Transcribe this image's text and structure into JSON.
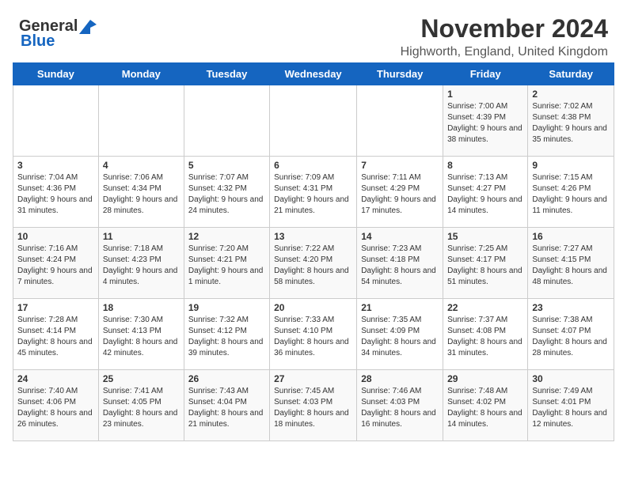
{
  "header": {
    "logo_general": "General",
    "logo_blue": "Blue",
    "month_title": "November 2024",
    "location": "Highworth, England, United Kingdom"
  },
  "days_of_week": [
    "Sunday",
    "Monday",
    "Tuesday",
    "Wednesday",
    "Thursday",
    "Friday",
    "Saturday"
  ],
  "weeks": [
    [
      {
        "day": "",
        "info": ""
      },
      {
        "day": "",
        "info": ""
      },
      {
        "day": "",
        "info": ""
      },
      {
        "day": "",
        "info": ""
      },
      {
        "day": "",
        "info": ""
      },
      {
        "day": "1",
        "info": "Sunrise: 7:00 AM\nSunset: 4:39 PM\nDaylight: 9 hours and 38 minutes."
      },
      {
        "day": "2",
        "info": "Sunrise: 7:02 AM\nSunset: 4:38 PM\nDaylight: 9 hours and 35 minutes."
      }
    ],
    [
      {
        "day": "3",
        "info": "Sunrise: 7:04 AM\nSunset: 4:36 PM\nDaylight: 9 hours and 31 minutes."
      },
      {
        "day": "4",
        "info": "Sunrise: 7:06 AM\nSunset: 4:34 PM\nDaylight: 9 hours and 28 minutes."
      },
      {
        "day": "5",
        "info": "Sunrise: 7:07 AM\nSunset: 4:32 PM\nDaylight: 9 hours and 24 minutes."
      },
      {
        "day": "6",
        "info": "Sunrise: 7:09 AM\nSunset: 4:31 PM\nDaylight: 9 hours and 21 minutes."
      },
      {
        "day": "7",
        "info": "Sunrise: 7:11 AM\nSunset: 4:29 PM\nDaylight: 9 hours and 17 minutes."
      },
      {
        "day": "8",
        "info": "Sunrise: 7:13 AM\nSunset: 4:27 PM\nDaylight: 9 hours and 14 minutes."
      },
      {
        "day": "9",
        "info": "Sunrise: 7:15 AM\nSunset: 4:26 PM\nDaylight: 9 hours and 11 minutes."
      }
    ],
    [
      {
        "day": "10",
        "info": "Sunrise: 7:16 AM\nSunset: 4:24 PM\nDaylight: 9 hours and 7 minutes."
      },
      {
        "day": "11",
        "info": "Sunrise: 7:18 AM\nSunset: 4:23 PM\nDaylight: 9 hours and 4 minutes."
      },
      {
        "day": "12",
        "info": "Sunrise: 7:20 AM\nSunset: 4:21 PM\nDaylight: 9 hours and 1 minute."
      },
      {
        "day": "13",
        "info": "Sunrise: 7:22 AM\nSunset: 4:20 PM\nDaylight: 8 hours and 58 minutes."
      },
      {
        "day": "14",
        "info": "Sunrise: 7:23 AM\nSunset: 4:18 PM\nDaylight: 8 hours and 54 minutes."
      },
      {
        "day": "15",
        "info": "Sunrise: 7:25 AM\nSunset: 4:17 PM\nDaylight: 8 hours and 51 minutes."
      },
      {
        "day": "16",
        "info": "Sunrise: 7:27 AM\nSunset: 4:15 PM\nDaylight: 8 hours and 48 minutes."
      }
    ],
    [
      {
        "day": "17",
        "info": "Sunrise: 7:28 AM\nSunset: 4:14 PM\nDaylight: 8 hours and 45 minutes."
      },
      {
        "day": "18",
        "info": "Sunrise: 7:30 AM\nSunset: 4:13 PM\nDaylight: 8 hours and 42 minutes."
      },
      {
        "day": "19",
        "info": "Sunrise: 7:32 AM\nSunset: 4:12 PM\nDaylight: 8 hours and 39 minutes."
      },
      {
        "day": "20",
        "info": "Sunrise: 7:33 AM\nSunset: 4:10 PM\nDaylight: 8 hours and 36 minutes."
      },
      {
        "day": "21",
        "info": "Sunrise: 7:35 AM\nSunset: 4:09 PM\nDaylight: 8 hours and 34 minutes."
      },
      {
        "day": "22",
        "info": "Sunrise: 7:37 AM\nSunset: 4:08 PM\nDaylight: 8 hours and 31 minutes."
      },
      {
        "day": "23",
        "info": "Sunrise: 7:38 AM\nSunset: 4:07 PM\nDaylight: 8 hours and 28 minutes."
      }
    ],
    [
      {
        "day": "24",
        "info": "Sunrise: 7:40 AM\nSunset: 4:06 PM\nDaylight: 8 hours and 26 minutes."
      },
      {
        "day": "25",
        "info": "Sunrise: 7:41 AM\nSunset: 4:05 PM\nDaylight: 8 hours and 23 minutes."
      },
      {
        "day": "26",
        "info": "Sunrise: 7:43 AM\nSunset: 4:04 PM\nDaylight: 8 hours and 21 minutes."
      },
      {
        "day": "27",
        "info": "Sunrise: 7:45 AM\nSunset: 4:03 PM\nDaylight: 8 hours and 18 minutes."
      },
      {
        "day": "28",
        "info": "Sunrise: 7:46 AM\nSunset: 4:03 PM\nDaylight: 8 hours and 16 minutes."
      },
      {
        "day": "29",
        "info": "Sunrise: 7:48 AM\nSunset: 4:02 PM\nDaylight: 8 hours and 14 minutes."
      },
      {
        "day": "30",
        "info": "Sunrise: 7:49 AM\nSunset: 4:01 PM\nDaylight: 8 hours and 12 minutes."
      }
    ]
  ]
}
